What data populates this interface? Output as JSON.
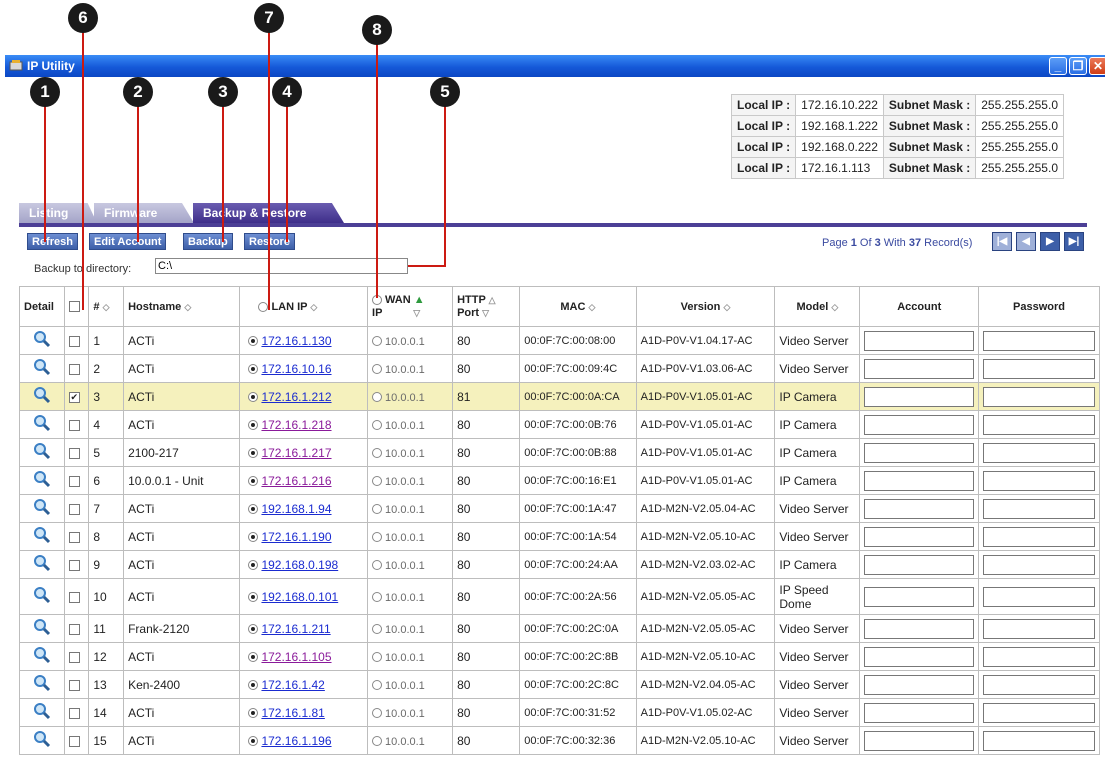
{
  "callouts": [
    "1",
    "2",
    "3",
    "4",
    "5",
    "6",
    "7",
    "8"
  ],
  "window": {
    "title": "IP Utility",
    "icon": "app-icon"
  },
  "local_ips": [
    {
      "label": "Local IP :",
      "ip": "172.16.10.222",
      "mask_label": "Subnet Mask :",
      "mask": "255.255.255.0"
    },
    {
      "label": "Local IP :",
      "ip": "192.168.1.222",
      "mask_label": "Subnet Mask :",
      "mask": "255.255.255.0"
    },
    {
      "label": "Local IP :",
      "ip": "192.168.0.222",
      "mask_label": "Subnet Mask :",
      "mask": "255.255.255.0"
    },
    {
      "label": "Local IP :",
      "ip": "172.16.1.113",
      "mask_label": "Subnet Mask :",
      "mask": "255.255.255.0"
    }
  ],
  "tabs": [
    "Listing",
    "Firmware",
    "Backup & Restore"
  ],
  "actions": [
    "Refresh",
    "Edit Account",
    "Backup",
    "Restore"
  ],
  "paging": {
    "prefix": "Page ",
    "page": "1",
    "of": " Of ",
    "total": "3",
    "with": " With ",
    "records": "37",
    "suffix": " Record(s)"
  },
  "backup": {
    "label": "Backup to directory:",
    "value": "C:\\"
  },
  "columns": {
    "detail": "Detail",
    "num": "#",
    "hostname": "Hostname",
    "lan": "LAN IP",
    "wan1": "WAN",
    "wan2": "IP",
    "http1": "HTTP",
    "http2": "Port",
    "mac": "MAC",
    "version": "Version",
    "model": "Model",
    "account": "Account",
    "password": "Password"
  },
  "rows": [
    {
      "n": "1",
      "host": "ACTi",
      "lan": "172.16.1.130",
      "wan": "10.0.0.1",
      "port": "80",
      "mac": "00:0F:7C:00:08:00",
      "ver": "A1D-P0V-V1.04.17-AC",
      "model": "Video Server"
    },
    {
      "n": "2",
      "host": "ACTi",
      "lan": "172.16.10.16",
      "wan": "10.0.0.1",
      "port": "80",
      "mac": "00:0F:7C:00:09:4C",
      "ver": "A1D-P0V-V1.03.06-AC",
      "model": "Video Server"
    },
    {
      "n": "3",
      "host": "ACTi",
      "lan": "172.16.1.212",
      "wan": "10.0.0.1",
      "port": "81",
      "mac": "00:0F:7C:00:0A:CA",
      "ver": "A1D-P0V-V1.05.01-AC",
      "model": "IP Camera",
      "selected": true
    },
    {
      "n": "4",
      "host": "ACTi",
      "lan": "172.16.1.218",
      "wan": "10.0.0.1",
      "port": "80",
      "mac": "00:0F:7C:00:0B:76",
      "ver": "A1D-P0V-V1.05.01-AC",
      "model": "IP Camera",
      "visited": true
    },
    {
      "n": "5",
      "host": "2100-217",
      "lan": "172.16.1.217",
      "wan": "10.0.0.1",
      "port": "80",
      "mac": "00:0F:7C:00:0B:88",
      "ver": "A1D-P0V-V1.05.01-AC",
      "model": "IP Camera",
      "visited": true
    },
    {
      "n": "6",
      "host": "10.0.0.1 - Unit",
      "lan": "172.16.1.216",
      "wan": "10.0.0.1",
      "port": "80",
      "mac": "00:0F:7C:00:16:E1",
      "ver": "A1D-P0V-V1.05.01-AC",
      "model": "IP Camera",
      "visited": true
    },
    {
      "n": "7",
      "host": "ACTi",
      "lan": "192.168.1.94",
      "wan": "10.0.0.1",
      "port": "80",
      "mac": "00:0F:7C:00:1A:47",
      "ver": "A1D-M2N-V2.05.04-AC",
      "model": "Video Server"
    },
    {
      "n": "8",
      "host": "ACTi",
      "lan": "172.16.1.190",
      "wan": "10.0.0.1",
      "port": "80",
      "mac": "00:0F:7C:00:1A:54",
      "ver": "A1D-M2N-V2.05.10-AC",
      "model": "Video Server"
    },
    {
      "n": "9",
      "host": "ACTi",
      "lan": "192.168.0.198",
      "wan": "10.0.0.1",
      "port": "80",
      "mac": "00:0F:7C:00:24:AA",
      "ver": "A1D-M2N-V2.03.02-AC",
      "model": "IP Camera"
    },
    {
      "n": "10",
      "host": "ACTi",
      "lan": "192.168.0.101",
      "wan": "10.0.0.1",
      "port": "80",
      "mac": "00:0F:7C:00:2A:56",
      "ver": "A1D-M2N-V2.05.05-AC",
      "model": "IP Speed Dome",
      "tall": true
    },
    {
      "n": "11",
      "host": "Frank-2120",
      "lan": "172.16.1.211",
      "wan": "10.0.0.1",
      "port": "80",
      "mac": "00:0F:7C:00:2C:0A",
      "ver": "A1D-M2N-V2.05.05-AC",
      "model": "Video Server"
    },
    {
      "n": "12",
      "host": "ACTi",
      "lan": "172.16.1.105",
      "wan": "10.0.0.1",
      "port": "80",
      "mac": "00:0F:7C:00:2C:8B",
      "ver": "A1D-M2N-V2.05.10-AC",
      "model": "Video Server",
      "visited": true
    },
    {
      "n": "13",
      "host": "Ken-2400",
      "lan": "172.16.1.42",
      "wan": "10.0.0.1",
      "port": "80",
      "mac": "00:0F:7C:00:2C:8C",
      "ver": "A1D-M2N-V2.04.05-AC",
      "model": "Video Server"
    },
    {
      "n": "14",
      "host": "ACTi",
      "lan": "172.16.1.81",
      "wan": "10.0.0.1",
      "port": "80",
      "mac": "00:0F:7C:00:31:52",
      "ver": "A1D-P0V-V1.05.02-AC",
      "model": "Video Server"
    },
    {
      "n": "15",
      "host": "ACTi",
      "lan": "172.16.1.196",
      "wan": "10.0.0.1",
      "port": "80",
      "mac": "00:0F:7C:00:32:36",
      "ver": "A1D-M2N-V2.05.10-AC",
      "model": "Video Server"
    }
  ]
}
